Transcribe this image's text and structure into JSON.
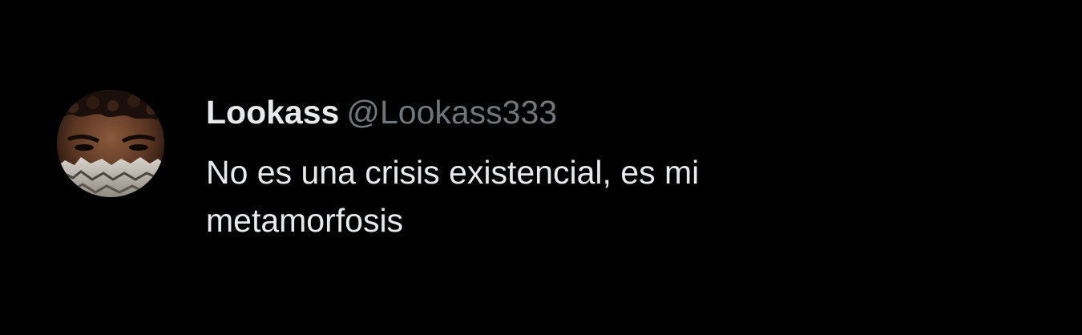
{
  "tweet": {
    "display_name": "Lookass",
    "handle": "@Lookass333",
    "text": "No es una crisis existencial, es mi metamorfosis"
  },
  "colors": {
    "background": "#000000",
    "name": "#e7e9ea",
    "handle": "#71767b",
    "text": "#e7e9ea"
  },
  "avatar": {
    "icon": "profile-photo"
  }
}
